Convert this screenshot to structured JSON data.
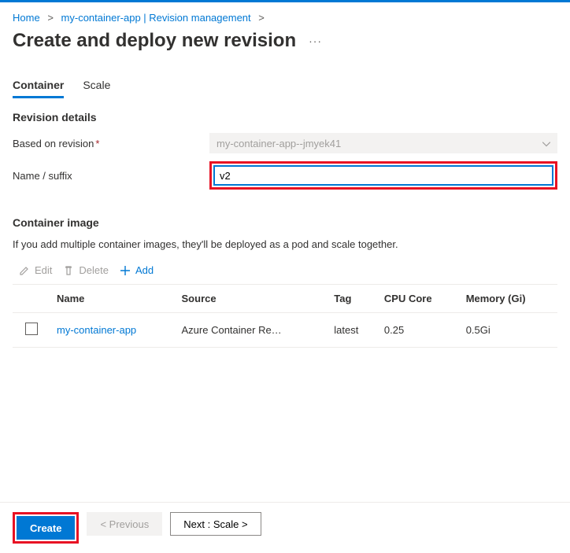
{
  "breadcrumb": {
    "home": "Home",
    "app": "my-container-app | Revision management"
  },
  "page_title": "Create and deploy new revision",
  "tabs": {
    "container": "Container",
    "scale": "Scale"
  },
  "revision_details": {
    "heading": "Revision details",
    "based_on_label": "Based on revision",
    "based_on_value": "my-container-app--jmyek41",
    "name_suffix_label": "Name / suffix",
    "name_suffix_value": "v2"
  },
  "container_image": {
    "heading": "Container image",
    "description": "If you add multiple container images, they'll be deployed as a pod and scale together."
  },
  "toolbar": {
    "edit": "Edit",
    "delete": "Delete",
    "add": "Add"
  },
  "table": {
    "headers": {
      "name": "Name",
      "source": "Source",
      "tag": "Tag",
      "cpu": "CPU Core",
      "memory": "Memory (Gi)"
    },
    "rows": [
      {
        "name": "my-container-app",
        "source": "Azure Container Re…",
        "tag": "latest",
        "cpu": "0.25",
        "memory": "0.5Gi"
      }
    ]
  },
  "footer": {
    "create": "Create",
    "previous": "< Previous",
    "next": "Next : Scale >"
  }
}
